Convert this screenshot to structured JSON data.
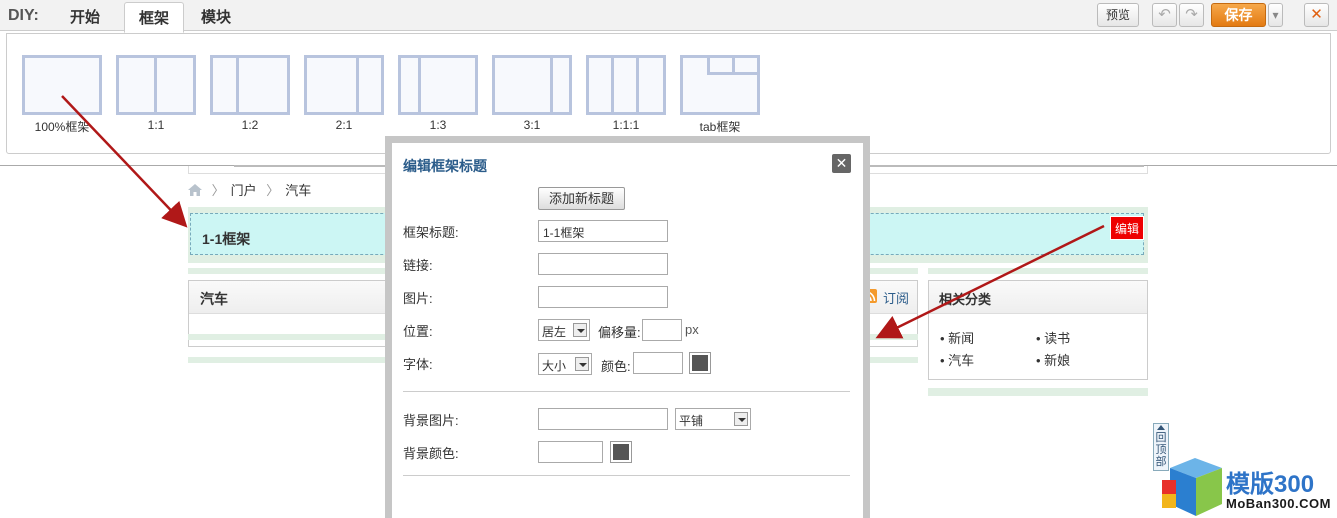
{
  "toolbar": {
    "diy_label": "DIY:",
    "tabs": [
      "开始",
      "框架",
      "模块"
    ],
    "preview_label": "预览",
    "save_label": "保存",
    "undo_icon": "↶",
    "redo_icon": "↷",
    "close_icon": "✕",
    "dropdown_icon": "▾"
  },
  "palette": {
    "frames": [
      "100%框架",
      "1:1",
      "1:2",
      "2:1",
      "1:3",
      "3:1",
      "1:1:1",
      "tab框架"
    ]
  },
  "page": {
    "breadcrumb": [
      "门户",
      "汽车"
    ],
    "frame_title": "1-1框架",
    "edit_label": "编辑",
    "left_box_title": "汽车",
    "subscribe_label": "订阅",
    "right_box_title": "相关分类",
    "categories": [
      "新闻",
      "读书",
      "汽车",
      "新娘"
    ],
    "back_to_top": "回顶部"
  },
  "dialog": {
    "title": "编辑框架标题",
    "close_icon": "✕",
    "add_title_button": "添加新标题",
    "fields": {
      "title_label": "框架标题:",
      "title_value": "1-1框架",
      "link_label": "链接:",
      "image_label": "图片:",
      "position_label": "位置:",
      "position_value": "居左",
      "offset_label": "偏移量:",
      "offset_unit": "px",
      "font_label": "字体:",
      "font_size_value": "大小",
      "color_label": "颜色:",
      "bg_image_label": "背景图片:",
      "bg_repeat_value": "平铺",
      "bg_color_label": "背景颜色:"
    }
  },
  "logo": {
    "brand": "模版300",
    "domain": "MoBan300.COM"
  },
  "colors": {
    "accent_save": "#e37a12",
    "frame_highlight": "#ccf6f4",
    "edit_red": "#ee0000",
    "arrow": "#b01818"
  }
}
